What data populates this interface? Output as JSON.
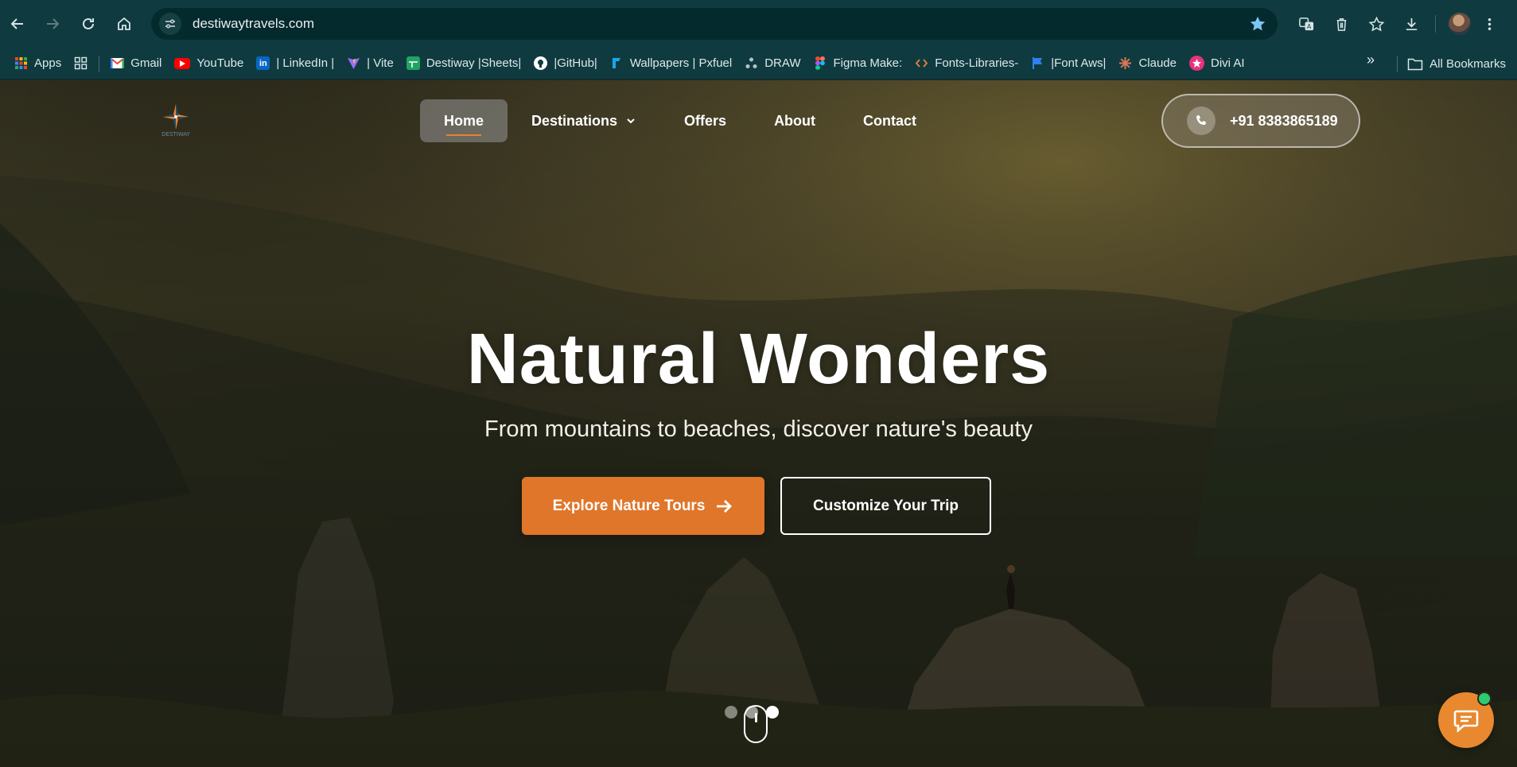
{
  "browser": {
    "url": "destiwaytravels.com",
    "bookmarks": [
      {
        "label": "Apps",
        "icon": "apps-grid-icon"
      },
      {
        "label": "",
        "icon": "grid-icon"
      },
      {
        "label": "Gmail",
        "icon": "gmail-icon"
      },
      {
        "label": "YouTube",
        "icon": "youtube-icon"
      },
      {
        "label": "| LinkedIn |",
        "icon": "linkedin-icon"
      },
      {
        "label": "| Vite",
        "icon": "vite-icon"
      },
      {
        "label": "Destiway |Sheets|",
        "icon": "sheets-icon"
      },
      {
        "label": "|GitHub|",
        "icon": "github-icon"
      },
      {
        "label": "Wallpapers | Pxfuel",
        "icon": "pxfuel-icon"
      },
      {
        "label": "DRAW",
        "icon": "draw-icon"
      },
      {
        "label": "Figma Make:",
        "icon": "figma-icon"
      },
      {
        "label": "Fonts-Libraries-",
        "icon": "code-icon"
      },
      {
        "label": "|Font Aws|",
        "icon": "flag-icon"
      },
      {
        "label": "Claude",
        "icon": "claude-icon"
      },
      {
        "label": "Divi AI",
        "icon": "divi-icon"
      }
    ],
    "more_bookmarks": "»",
    "all_bookmarks": "All Bookmarks"
  },
  "site": {
    "logo_alt": "DESTIWAY",
    "nav": [
      {
        "label": "Home",
        "active": true
      },
      {
        "label": "Destinations",
        "has_dropdown": true
      },
      {
        "label": "Offers"
      },
      {
        "label": "About"
      },
      {
        "label": "Contact"
      }
    ],
    "phone": "+91 8383865189"
  },
  "hero": {
    "title": "Natural Wonders",
    "subtitle": "From mountains to beaches, discover nature's beauty",
    "primary_cta": "Explore Nature Tours",
    "secondary_cta": "Customize Your Trip",
    "slides_total": 3,
    "active_slide": 3
  },
  "colors": {
    "browser_bar": "#0f3b40",
    "accent_orange": "#e0762a",
    "chat_online": "#2ecc71"
  }
}
